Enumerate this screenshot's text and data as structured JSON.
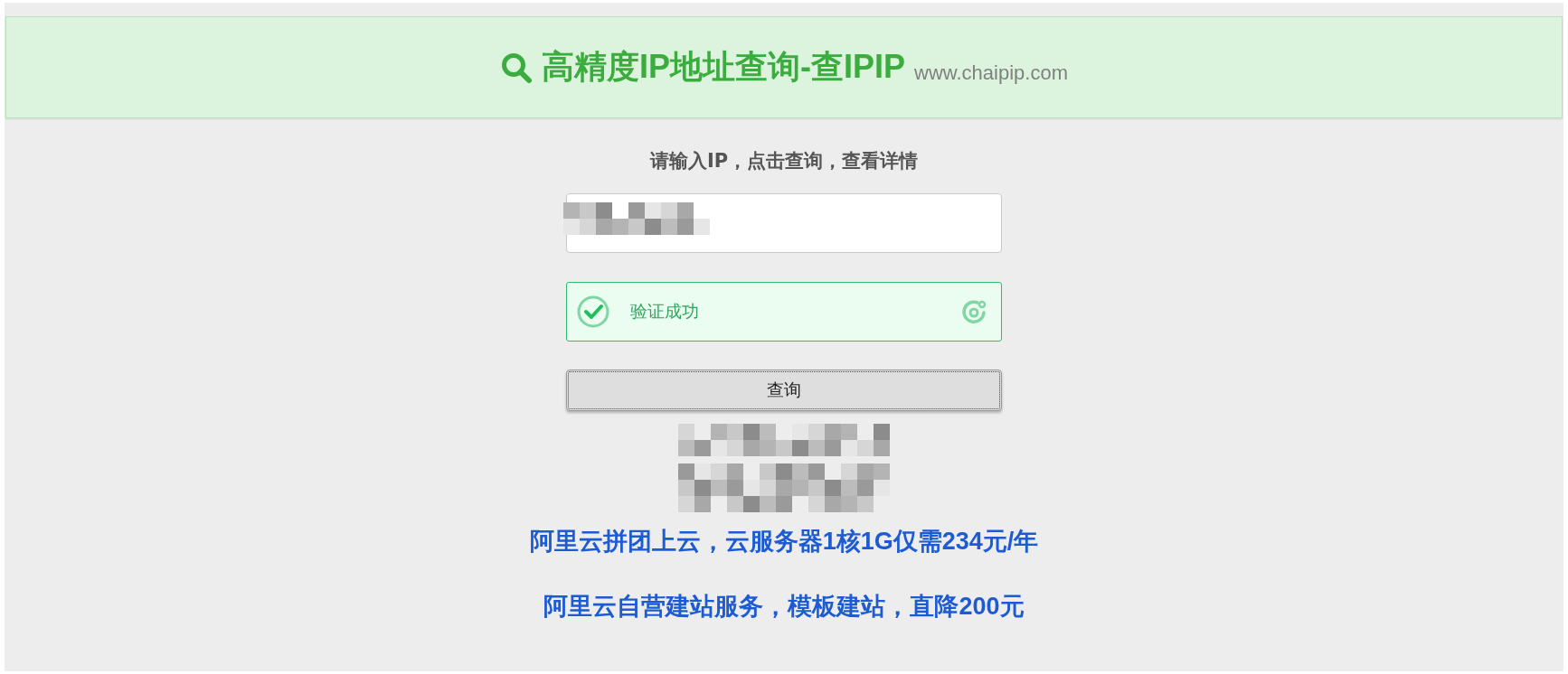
{
  "header": {
    "title": "高精度IP地址查询-查IPIP",
    "domain": "www.chaipip.com"
  },
  "prompt": "请输入IP，点击查询，查看详情",
  "captcha": {
    "status_text": "验证成功",
    "verified": true
  },
  "query_button": "查询",
  "ad_links": [
    "阿里云拼团上云，云服务器1核1G仅需234元/年",
    "阿里云自营建站服务，模板建站，直降200元"
  ]
}
